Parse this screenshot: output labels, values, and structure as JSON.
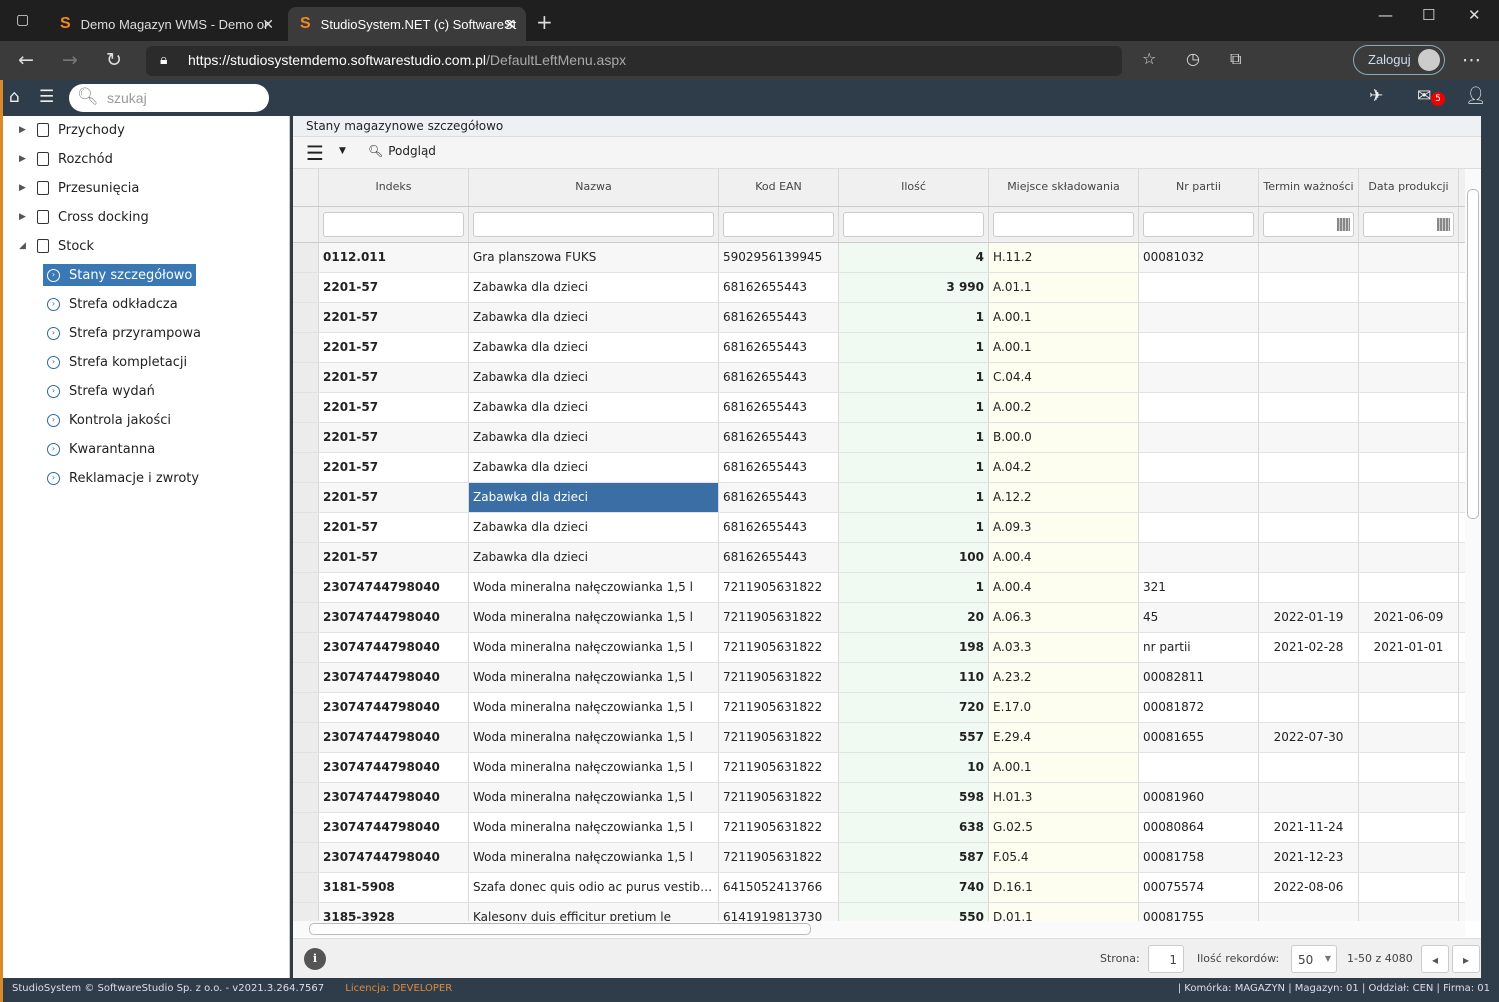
{
  "browser": {
    "tabs": [
      {
        "title": "Demo Magazyn WMS - Demo or"
      },
      {
        "title": "StudioSystem.NET (c) SoftwareSt"
      }
    ],
    "url_host": "https://studiosystemdemo.softwarestudio.com.pl",
    "url_path": "/DefaultLeftMenu.aspx",
    "login_label": "Zaloguj"
  },
  "header": {
    "search_placeholder": "szukaj",
    "mail_count": "5"
  },
  "sidebar": {
    "items": [
      {
        "label": "Przychody"
      },
      {
        "label": "Rozchód"
      },
      {
        "label": "Przesunięcia"
      },
      {
        "label": "Cross docking"
      },
      {
        "label": "Stock"
      }
    ],
    "sub_items": [
      {
        "label": "Stany szczegółowo",
        "selected": true
      },
      {
        "label": "Strefa odkładcza"
      },
      {
        "label": "Strefa przyrampowa"
      },
      {
        "label": "Strefa kompletacji"
      },
      {
        "label": "Strefa wydań"
      },
      {
        "label": "Kontrola jakości"
      },
      {
        "label": "Kwarantanna"
      },
      {
        "label": "Reklamacje i zwroty"
      }
    ]
  },
  "main": {
    "title": "Stany magazynowe szczegółowo",
    "preview_label": "Podgląd",
    "columns": [
      "Indeks",
      "Nazwa",
      "Kod EAN",
      "Ilość",
      "Miejsce składowania",
      "Nr partii",
      "Termin ważności",
      "Data produkcji"
    ],
    "rows": [
      [
        "0112.011",
        "Gra planszowa FUKS",
        "5902956139945",
        "4",
        "H.11.2",
        "00081032",
        "",
        ""
      ],
      [
        "2201-57",
        "Zabawka dla dzieci",
        "68162655443",
        "3 990",
        "A.01.1",
        "",
        "",
        ""
      ],
      [
        "2201-57",
        "Zabawka dla dzieci",
        "68162655443",
        "1",
        "A.00.1",
        "",
        "",
        ""
      ],
      [
        "2201-57",
        "Zabawka dla dzieci",
        "68162655443",
        "1",
        "A.00.1",
        "",
        "",
        ""
      ],
      [
        "2201-57",
        "Zabawka dla dzieci",
        "68162655443",
        "1",
        "C.04.4",
        "",
        "",
        ""
      ],
      [
        "2201-57",
        "Zabawka dla dzieci",
        "68162655443",
        "1",
        "A.00.2",
        "",
        "",
        ""
      ],
      [
        "2201-57",
        "Zabawka dla dzieci",
        "68162655443",
        "1",
        "B.00.0",
        "",
        "",
        ""
      ],
      [
        "2201-57",
        "Zabawka dla dzieci",
        "68162655443",
        "1",
        "A.04.2",
        "",
        "",
        ""
      ],
      [
        "2201-57",
        "Zabawka dla dzieci",
        "68162655443",
        "1",
        "A.12.2",
        "",
        "",
        ""
      ],
      [
        "2201-57",
        "Zabawka dla dzieci",
        "68162655443",
        "1",
        "A.09.3",
        "",
        "",
        ""
      ],
      [
        "2201-57",
        "Zabawka dla dzieci",
        "68162655443",
        "100",
        "A.00.4",
        "",
        "",
        ""
      ],
      [
        "23074744798040",
        "Woda mineralna nałęczowianka 1,5 l",
        "7211905631822",
        "1",
        "A.00.4",
        "321",
        "",
        ""
      ],
      [
        "23074744798040",
        "Woda mineralna nałęczowianka 1,5 l",
        "7211905631822",
        "20",
        "A.06.3",
        "45",
        "2022-01-19",
        "2021-06-09"
      ],
      [
        "23074744798040",
        "Woda mineralna nałęczowianka 1,5 l",
        "7211905631822",
        "198",
        "A.03.3",
        "nr partii",
        "2021-02-28",
        "2021-01-01"
      ],
      [
        "23074744798040",
        "Woda mineralna nałęczowianka 1,5 l",
        "7211905631822",
        "110",
        "A.23.2",
        "00082811",
        "",
        ""
      ],
      [
        "23074744798040",
        "Woda mineralna nałęczowianka 1,5 l",
        "7211905631822",
        "720",
        "E.17.0",
        "00081872",
        "",
        ""
      ],
      [
        "23074744798040",
        "Woda mineralna nałęczowianka 1,5 l",
        "7211905631822",
        "557",
        "E.29.4",
        "00081655",
        "2022-07-30",
        ""
      ],
      [
        "23074744798040",
        "Woda mineralna nałęczowianka 1,5 l",
        "7211905631822",
        "10",
        "A.00.1",
        "",
        "",
        ""
      ],
      [
        "23074744798040",
        "Woda mineralna nałęczowianka 1,5 l",
        "7211905631822",
        "598",
        "H.01.3",
        "00081960",
        "",
        ""
      ],
      [
        "23074744798040",
        "Woda mineralna nałęczowianka 1,5 l",
        "7211905631822",
        "638",
        "G.02.5",
        "00080864",
        "2021-11-24",
        ""
      ],
      [
        "23074744798040",
        "Woda mineralna nałęczowianka 1,5 l",
        "7211905631822",
        "587",
        "F.05.4",
        "00081758",
        "2021-12-23",
        ""
      ],
      [
        "3181-5908",
        "Szafa donec quis odio ac purus vestibulum",
        "6415052413766",
        "740",
        "D.16.1",
        "00075574",
        "2022-08-06",
        ""
      ],
      [
        "3185-3928",
        "Kalesony duis efficitur pretium le",
        "6141919813730",
        "550",
        "D.01.1",
        "00081755",
        "",
        ""
      ]
    ],
    "selected_cell": {
      "row": 8,
      "col": 1
    }
  },
  "pager": {
    "page_label": "Strona:",
    "page": "1",
    "records_label": "Ilość rekordów:",
    "page_size": "50",
    "range": "1-50 z 4080"
  },
  "footer": {
    "copyright": "StudioSystem © SoftwareStudio Sp. z o.o. - v2021.3.264.7567",
    "license_label": "Licencja:",
    "license": "DEVELOPER",
    "context": "| Komórka: MAGAZYN | Magazyn: 01 | Oddział: CEN | Firma: 01"
  }
}
